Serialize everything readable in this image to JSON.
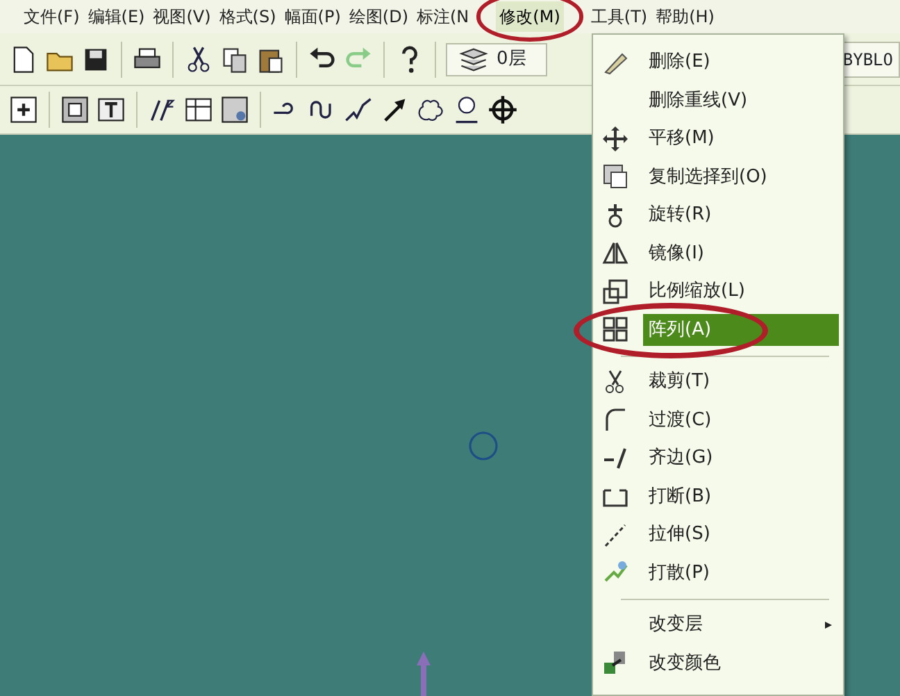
{
  "menubar": [
    {
      "label": "文件(F)",
      "selected": false
    },
    {
      "label": "编辑(E)",
      "selected": false
    },
    {
      "label": "视图(V)",
      "selected": false
    },
    {
      "label": "格式(S)",
      "selected": false
    },
    {
      "label": "幅面(P)",
      "selected": false
    },
    {
      "label": "绘图(D)",
      "selected": false
    },
    {
      "label": "标注(N",
      "selected": false
    },
    {
      "label": "修改(M)",
      "selected": true
    },
    {
      "label": "工具(T)",
      "selected": false
    },
    {
      "label": "帮助(H)",
      "selected": false
    }
  ],
  "toolbar": {
    "layer_field": "0层",
    "linetype_field": "BYBLO"
  },
  "modify_menu": [
    {
      "kind": "item",
      "label": "删除(E)",
      "selected": false,
      "submenu": false
    },
    {
      "kind": "item",
      "label": "删除重线(V)",
      "selected": false,
      "submenu": false
    },
    {
      "kind": "item",
      "label": "平移(M)",
      "selected": false,
      "submenu": false
    },
    {
      "kind": "item",
      "label": "复制选择到(O)",
      "selected": false,
      "submenu": false
    },
    {
      "kind": "item",
      "label": "旋转(R)",
      "selected": false,
      "submenu": false
    },
    {
      "kind": "item",
      "label": "镜像(I)",
      "selected": false,
      "submenu": false
    },
    {
      "kind": "item",
      "label": "比例缩放(L)",
      "selected": false,
      "submenu": false
    },
    {
      "kind": "item",
      "label": "阵列(A)",
      "selected": true,
      "submenu": false
    },
    {
      "kind": "separator"
    },
    {
      "kind": "item",
      "label": "裁剪(T)",
      "selected": false,
      "submenu": false
    },
    {
      "kind": "item",
      "label": "过渡(C)",
      "selected": false,
      "submenu": false
    },
    {
      "kind": "item",
      "label": "齐边(G)",
      "selected": false,
      "submenu": false
    },
    {
      "kind": "item",
      "label": "打断(B)",
      "selected": false,
      "submenu": false
    },
    {
      "kind": "item",
      "label": "拉伸(S)",
      "selected": false,
      "submenu": false
    },
    {
      "kind": "item",
      "label": "打散(P)",
      "selected": false,
      "submenu": false
    },
    {
      "kind": "separator"
    },
    {
      "kind": "item",
      "label": "改变层",
      "selected": false,
      "submenu": true
    },
    {
      "kind": "item",
      "label": "改变颜色",
      "selected": false,
      "submenu": false
    }
  ]
}
